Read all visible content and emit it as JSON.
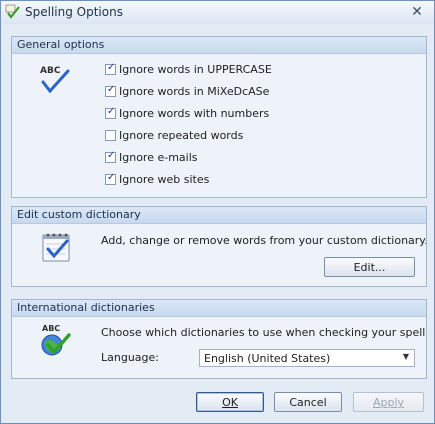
{
  "window": {
    "title": "Spelling Options"
  },
  "general": {
    "header": "General options",
    "options": [
      {
        "label": "Ignore words in UPPERCASE",
        "checked": true
      },
      {
        "label": "Ignore words in MiXeDcASe",
        "checked": true
      },
      {
        "label": "Ignore words with numbers",
        "checked": true
      },
      {
        "label": "Ignore repeated words",
        "checked": false
      },
      {
        "label": "Ignore e-mails",
        "checked": true
      },
      {
        "label": "Ignore web sites",
        "checked": true
      }
    ]
  },
  "custom_dictionary": {
    "header": "Edit custom dictionary",
    "description": "Add, change or remove words from your custom dictionary.",
    "edit_button": "Edit..."
  },
  "international": {
    "header": "International dictionaries",
    "description": "Choose which dictionaries to use when checking your spelling.",
    "language_label": "Language:",
    "language_value": "English (United States)"
  },
  "footer": {
    "ok_button": "OK",
    "cancel_button": "Cancel",
    "apply_button": "Apply"
  },
  "icons": {
    "app": "spell-check-icon",
    "abc": "abc-check-icon",
    "dictionary": "notepad-check-icon",
    "globe": "globe-check-icon"
  },
  "colors": {
    "accent": "#3b5fa3",
    "checkmark": "#2c63c7"
  }
}
